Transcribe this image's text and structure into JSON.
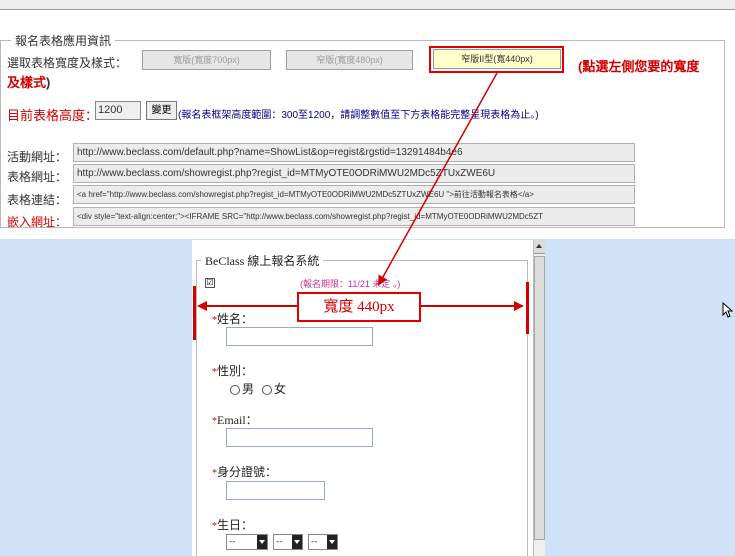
{
  "config": {
    "legend": "報名表格應用資訊",
    "width_style_label": "選取表格寬度及樣式：",
    "buttons": [
      {
        "label": "寬版(寬度700px)",
        "selected": false
      },
      {
        "label": "窄版(寬度480px)",
        "selected": false
      },
      {
        "label": "窄版II型(寬440px)",
        "selected": true
      }
    ],
    "instruction_part1": "(點選左側您要的寬度",
    "instruction_part2": "及樣式",
    "instruction_part3": ")",
    "height_label": "目前表格高度",
    "height_sep": "：",
    "height_value": "1200",
    "change_button": "變更",
    "height_hint": "(報名表框架高度範圍：300至1200，請調整數值至下方表格能完整呈現表格為止。)",
    "rows": [
      {
        "label": "活動網址：",
        "value": "http://www.beclass.com/default.php?name=ShowList&op=regist&rgstid=13291484b4e6"
      },
      {
        "label": "表格網址：",
        "value": "http://www.beclass.com/showregist.php?regist_id=MTMyOTE0ODRiMWU2MDc5ZTUxZWE6U"
      },
      {
        "label": "表格連結：",
        "value": "<a href=\"http://www.beclass.com/showregist.php?regist_id=MTMyOTE0ODRiMWU2MDc5ZTUxZWE6U                 \">前往活動報名表格</a>"
      },
      {
        "label": "嵌入網址：",
        "value": "<div style=\"text-align:center;\"><IFRAME SRC=\"http://www.beclass.com/showregist.php?regist_id=MTMyOTE0ODRiMWU2MDc5ZT"
      }
    ]
  },
  "form": {
    "legend": "BeClass 線上報名系統",
    "check_mark": "☑",
    "notice": "(報名期限：11/21 未定 。)",
    "width_label": "寬度 440px",
    "fields": [
      {
        "label": "姓名：",
        "star": "*"
      },
      {
        "label": "性別：",
        "star": "*"
      },
      {
        "label": "Email：",
        "star": "*"
      },
      {
        "label": "身分證號：",
        "star": "*"
      },
      {
        "label": "生日：",
        "star": "*"
      }
    ],
    "gender_options": [
      "男",
      "女"
    ],
    "birthday_selects": [
      "--",
      "--",
      "--"
    ]
  },
  "colors": {
    "accent_red": "#d40000",
    "background_blue": "#cfe2f7",
    "selected_button": "#ffffcc"
  }
}
